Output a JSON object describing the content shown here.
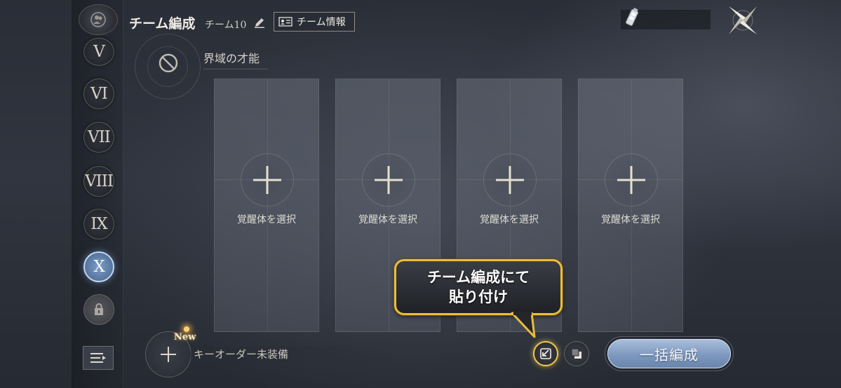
{
  "header": {
    "title": "チーム編成",
    "team_name": "チーム10",
    "team_info_label": "チーム情報"
  },
  "realm": {
    "label": "界域の才能"
  },
  "sidebar": {
    "items": [
      {
        "label": "V"
      },
      {
        "label": "VI"
      },
      {
        "label": "VII"
      },
      {
        "label": "VIII"
      },
      {
        "label": "IX"
      },
      {
        "label": "X",
        "active": true
      }
    ]
  },
  "slots": [
    {
      "label": "覚醒体を選択"
    },
    {
      "label": "覚醒体を選択"
    },
    {
      "label": "覚醒体を選択"
    },
    {
      "label": "覚醒体を選択"
    }
  ],
  "key_order": {
    "new_badge": "New",
    "label": "キーオーダー未装備"
  },
  "actions": {
    "bulk_label": "一括編成"
  },
  "callout": {
    "line1": "チーム編成にて",
    "line2": "貼り付け"
  },
  "colors": {
    "accent_gold": "#e9bd3c",
    "active_blue": "#6a85ad"
  }
}
